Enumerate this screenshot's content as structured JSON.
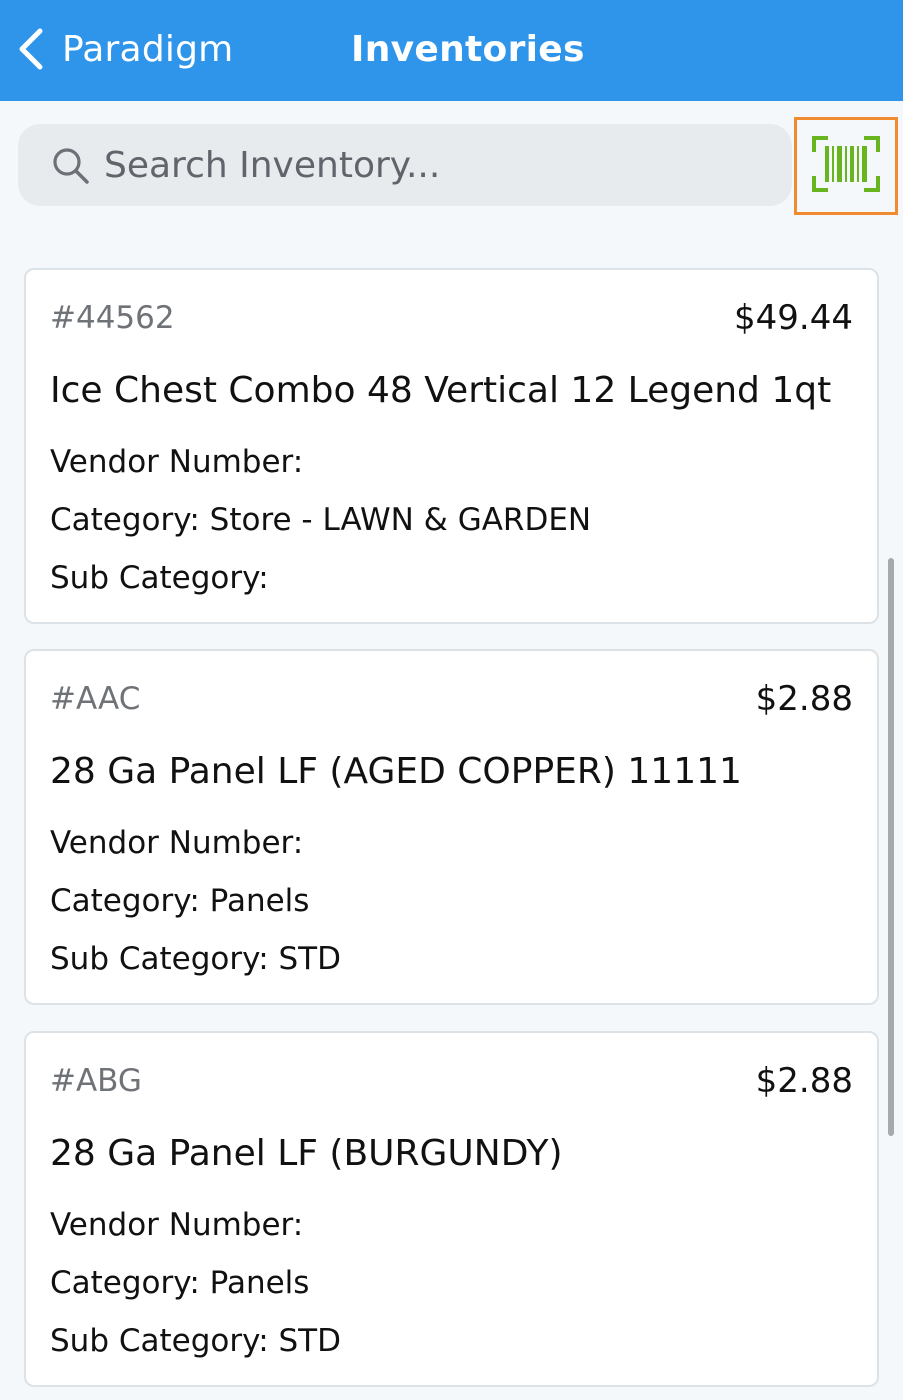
{
  "nav": {
    "back_label": "Paradigm",
    "title": "Inventories",
    "color": "#2f95ea"
  },
  "search": {
    "placeholder": "Search Inventory...",
    "value": ""
  },
  "scan_button": {
    "icon": "barcode-scan-icon",
    "icon_color": "#68b51f",
    "border_color": "#f08b2f"
  },
  "items": [
    {
      "sku": "#44562",
      "price": "$49.44",
      "name": "Ice Chest Combo 48 Vertical 12 Legend 1qt",
      "vendor": "Vendor Number:",
      "category": "Category: Store - LAWN & GARDEN",
      "subcategory": "Sub Category:"
    },
    {
      "sku": "#AAC",
      "price": "$2.88",
      "name": "28 Ga Panel LF (AGED COPPER) 11111",
      "vendor": "Vendor Number:",
      "category": "Category: Panels",
      "subcategory": "Sub Category: STD"
    },
    {
      "sku": "#ABG",
      "price": "$2.88",
      "name": "28 Ga Panel LF (BURGUNDY)",
      "vendor": "Vendor Number:",
      "category": "Category: Panels",
      "subcategory": "Sub Category: STD"
    }
  ]
}
